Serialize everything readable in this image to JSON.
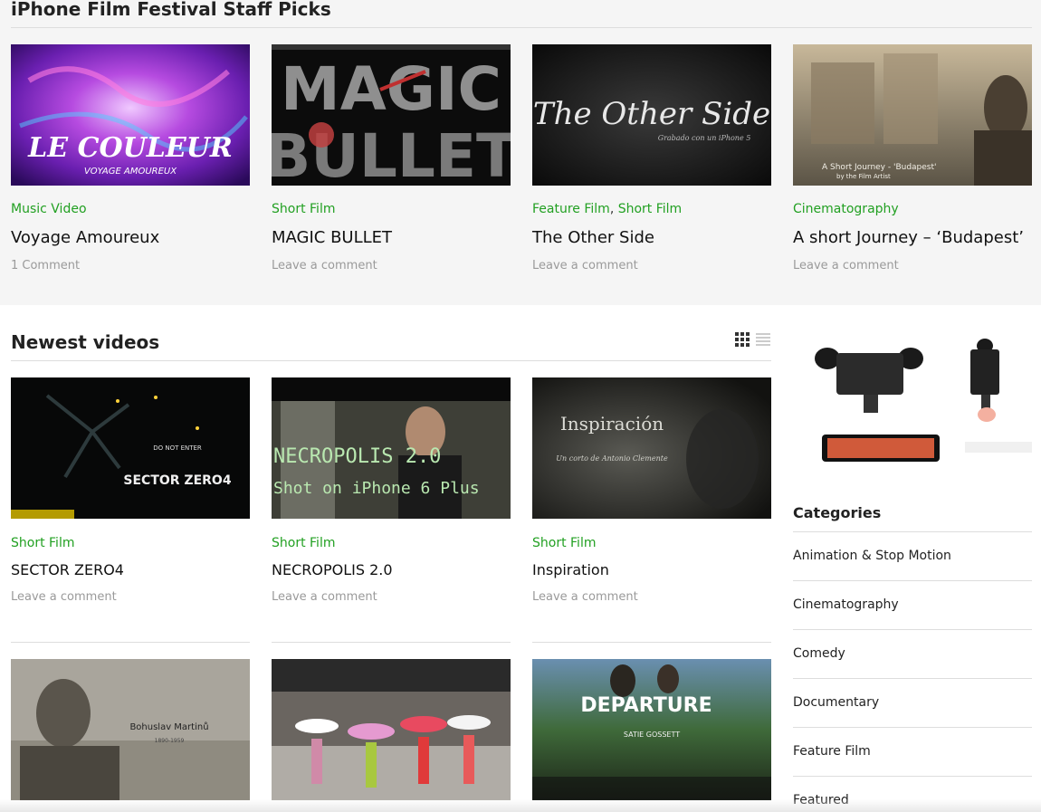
{
  "staff_picks": {
    "title": "iPhone Film Festival Staff Picks",
    "items": [
      {
        "categories": [
          "Music Video"
        ],
        "title": "Voyage Amoureux",
        "meta": "1 Comment",
        "thumb_text": "LE COULEUR",
        "thumb_sub": "VOYAGE AMOUREUX"
      },
      {
        "categories": [
          "Short Film"
        ],
        "title": "MAGIC BULLET",
        "meta": "Leave a comment",
        "thumb_text": "MAGIC",
        "thumb_sub": "BULLET"
      },
      {
        "categories": [
          "Feature Film",
          "Short Film"
        ],
        "title": "The Other Side",
        "meta": "Leave a comment",
        "thumb_text": "The Other Side",
        "thumb_sub": "Grabado con un iPhone 5"
      },
      {
        "categories": [
          "Cinematography"
        ],
        "title": "A short Journey – ‘Budapest’",
        "meta": "Leave a comment",
        "thumb_text": "A Short Journey - 'Budapest'",
        "thumb_sub": "by the Film Artist"
      }
    ]
  },
  "newest": {
    "title": "Newest videos",
    "rows": [
      [
        {
          "categories": [
            "Short Film"
          ],
          "title": "SECTOR ZERO4",
          "meta": "Leave a comment",
          "thumb_text": "SECTOR ZERO4",
          "thumb_sub": "DO NOT ENTER"
        },
        {
          "categories": [
            "Short Film"
          ],
          "title": "NECROPOLIS 2.0",
          "meta": "Leave a comment",
          "thumb_text": "NECROPOLIS 2.0",
          "thumb_sub": "Shot on iPhone 6 Plus"
        },
        {
          "categories": [
            "Short Film"
          ],
          "title": "Inspiration",
          "meta": "Leave a comment",
          "thumb_text": "Inspiración",
          "thumb_sub": "Un corto de Antonio Clemente"
        }
      ],
      [
        {
          "thumb_text": "Bohuslav Martinů",
          "thumb_sub": "1890-1959"
        },
        {
          "thumb_text": "",
          "thumb_sub": ""
        },
        {
          "thumb_text": "DEPARTURE",
          "thumb_sub": "SATIE GOSSETT"
        }
      ]
    ]
  },
  "sidebar": {
    "categories_title": "Categories",
    "categories": [
      "Animation & Stop Motion",
      "Cinematography",
      "Comedy",
      "Documentary",
      "Feature Film",
      "Featured"
    ]
  },
  "colors": {
    "category_green": "#22a022",
    "muted_gray": "#9a9a9a",
    "panel_bg": "#f5f5f5"
  }
}
